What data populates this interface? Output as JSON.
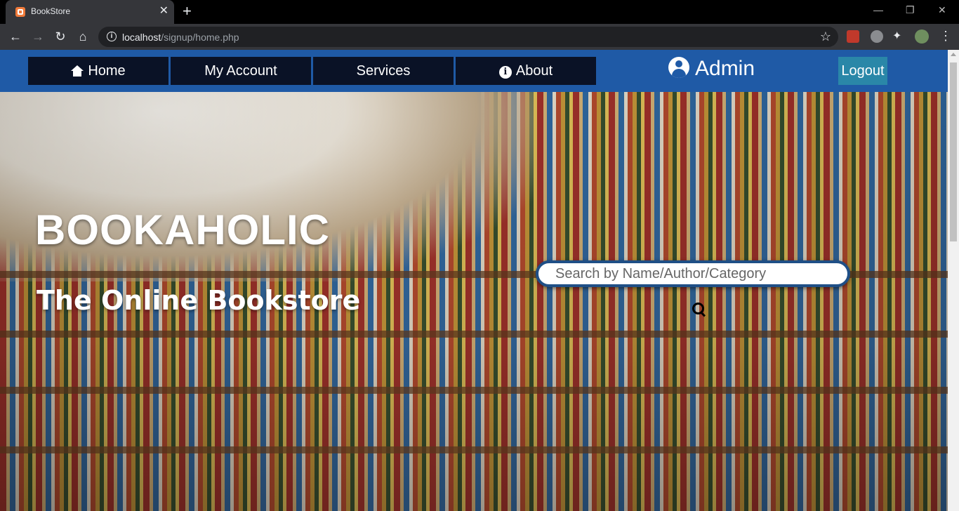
{
  "browser": {
    "tab_title": "BookStore",
    "tab_close": "✕",
    "new_tab": "+",
    "url_host": "localhost",
    "url_path": "/signup/home.php",
    "window_controls": {
      "minimize": "—",
      "maximize": "❐",
      "close": "✕"
    },
    "icons": [
      "back-icon",
      "forward-icon",
      "reload-icon",
      "home-icon",
      "info-icon",
      "star-icon",
      "extension-icon",
      "puzzle-icon",
      "profile-avatar",
      "menu-icon"
    ]
  },
  "navbar": {
    "items": [
      {
        "label": "Home",
        "icon": "home-icon"
      },
      {
        "label": "My Account"
      },
      {
        "label": "Services"
      },
      {
        "label": "About",
        "icon": "info-circle-icon"
      }
    ],
    "user_label": "Admin",
    "logout_label": "Logout",
    "colors": {
      "bar": "#1f5aa6",
      "item": "#0a1226",
      "logout": "#2a87a8"
    }
  },
  "hero": {
    "brand": "BOOKAHOLIC",
    "tagline": "The Online Bookstore",
    "search_placeholder": "Search by Name/Author/Category"
  }
}
